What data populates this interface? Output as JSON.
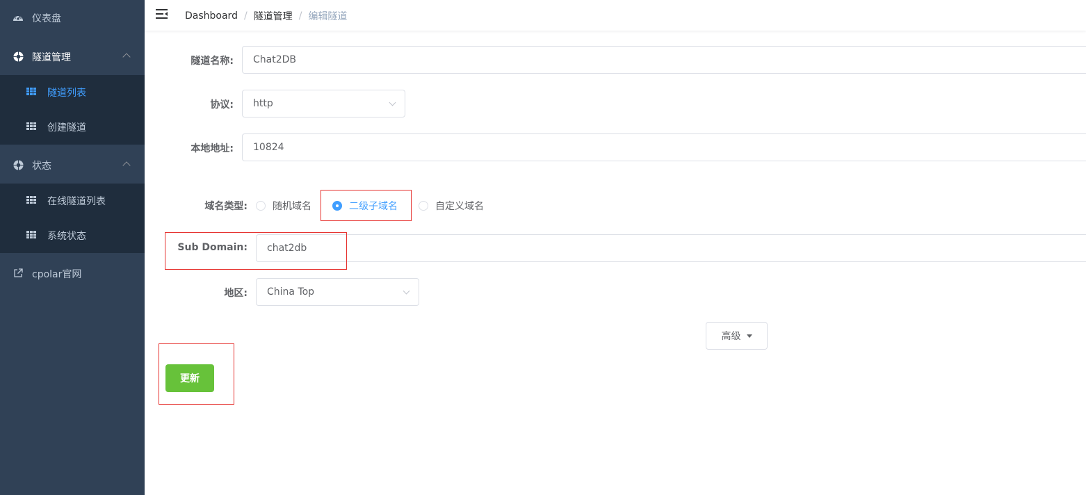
{
  "sidebar": {
    "items": [
      {
        "label": "仪表盘",
        "icon": "dashboard-icon"
      },
      {
        "label": "隧道管理",
        "icon": "tunnel-icon",
        "expanded": true,
        "children": [
          {
            "label": "隧道列表",
            "active": true
          },
          {
            "label": "创建隧道"
          }
        ]
      },
      {
        "label": "状态",
        "icon": "status-icon",
        "expanded": true,
        "children": [
          {
            "label": "在线隧道列表"
          },
          {
            "label": "系统状态"
          }
        ]
      },
      {
        "label": "cpolar官网",
        "icon": "external-link-icon"
      }
    ]
  },
  "breadcrumb": [
    "Dashboard",
    "隧道管理",
    "编辑隧道"
  ],
  "form": {
    "name_label": "隧道名称:",
    "name_value": "Chat2DB",
    "protocol_label": "协议:",
    "protocol_value": "http",
    "local_label": "本地地址:",
    "local_value": "10824",
    "domain_type_label": "域名类型:",
    "domain_types": [
      "随机域名",
      "二级子域名",
      "自定义域名"
    ],
    "domain_type_selected": "二级子域名",
    "subdomain_label": "Sub Domain:",
    "subdomain_value": "chat2db",
    "region_label": "地区:",
    "region_value": "China Top",
    "advanced_label": "高级",
    "update_label": "更新"
  },
  "colors": {
    "sidebar_bg": "#304156",
    "submenu_bg": "#1f2d3d",
    "active": "#409eff",
    "primary_success": "#67c23a",
    "highlight_box": "#e6312e"
  }
}
